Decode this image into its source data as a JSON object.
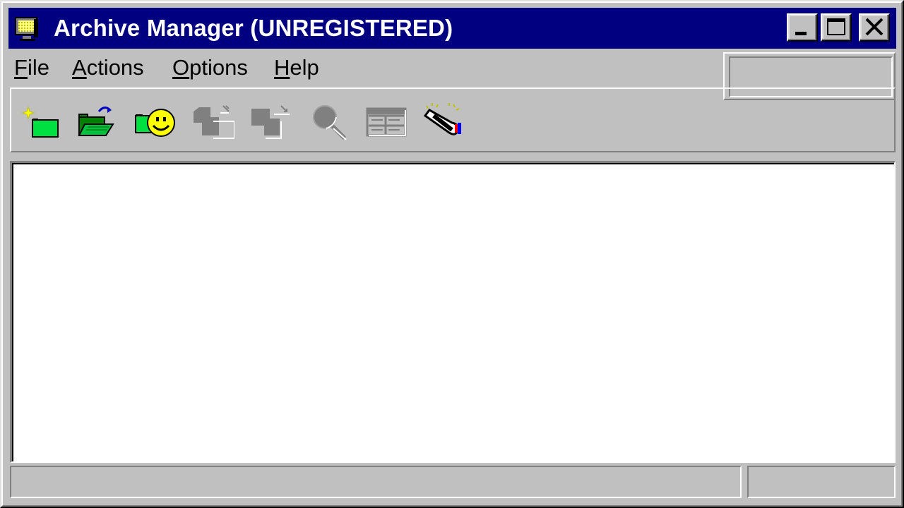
{
  "window": {
    "title": "Archive Manager (UNREGISTERED)",
    "title_bar_color": "#000080"
  },
  "title_controls": {
    "minimize": "minimize-icon",
    "maximize": "maximize-icon",
    "close": "close-icon"
  },
  "menu": {
    "items": [
      {
        "label": "File",
        "mnemonic": "F",
        "rest": "ile"
      },
      {
        "label": "Actions",
        "mnemonic": "A",
        "rest": "ctions"
      },
      {
        "label": "Options",
        "mnemonic": "O",
        "rest": "ptions"
      },
      {
        "label": "Help",
        "mnemonic": "H",
        "rest": "elp"
      }
    ]
  },
  "toolbar": {
    "buttons": [
      {
        "icon": "new-archive-icon",
        "enabled": true
      },
      {
        "icon": "open-archive-icon",
        "enabled": true
      },
      {
        "icon": "favorites-icon",
        "enabled": true
      },
      {
        "icon": "add-files-icon",
        "enabled": false
      },
      {
        "icon": "extract-icon",
        "enabled": false
      },
      {
        "icon": "view-icon",
        "enabled": false
      },
      {
        "icon": "checkout-icon",
        "enabled": false
      },
      {
        "icon": "wizard-icon",
        "enabled": true
      }
    ]
  },
  "statusbar": {
    "left_text": "",
    "right_text": ""
  }
}
